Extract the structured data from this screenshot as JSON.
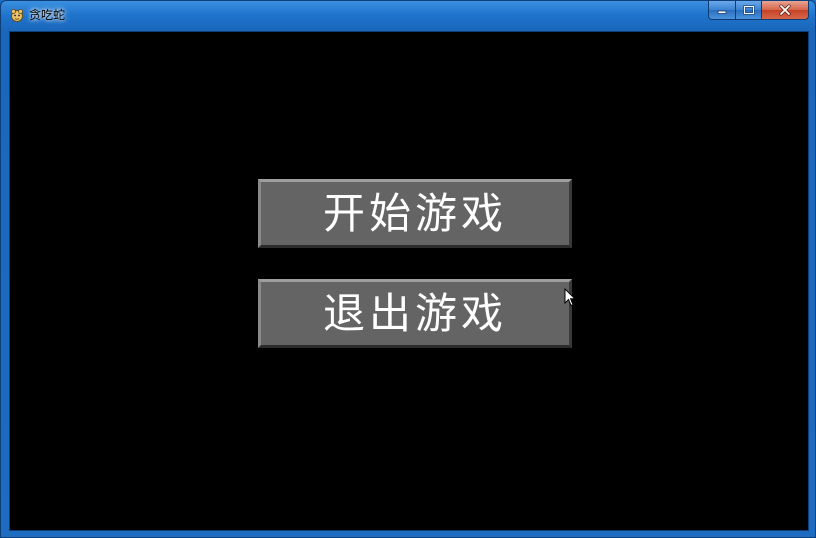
{
  "window": {
    "title": "贪吃蛇",
    "icon": "pygame-snake-icon"
  },
  "controls": {
    "minimize": "minimize-icon",
    "maximize": "maximize-icon",
    "close": "close-icon"
  },
  "menu": {
    "start_label": "开始游戏",
    "quit_label": "退出游戏"
  },
  "colors": {
    "background": "#000000",
    "button_face": "#646464",
    "button_text": "#ffffff",
    "titlebar": "#1d6cc2"
  }
}
